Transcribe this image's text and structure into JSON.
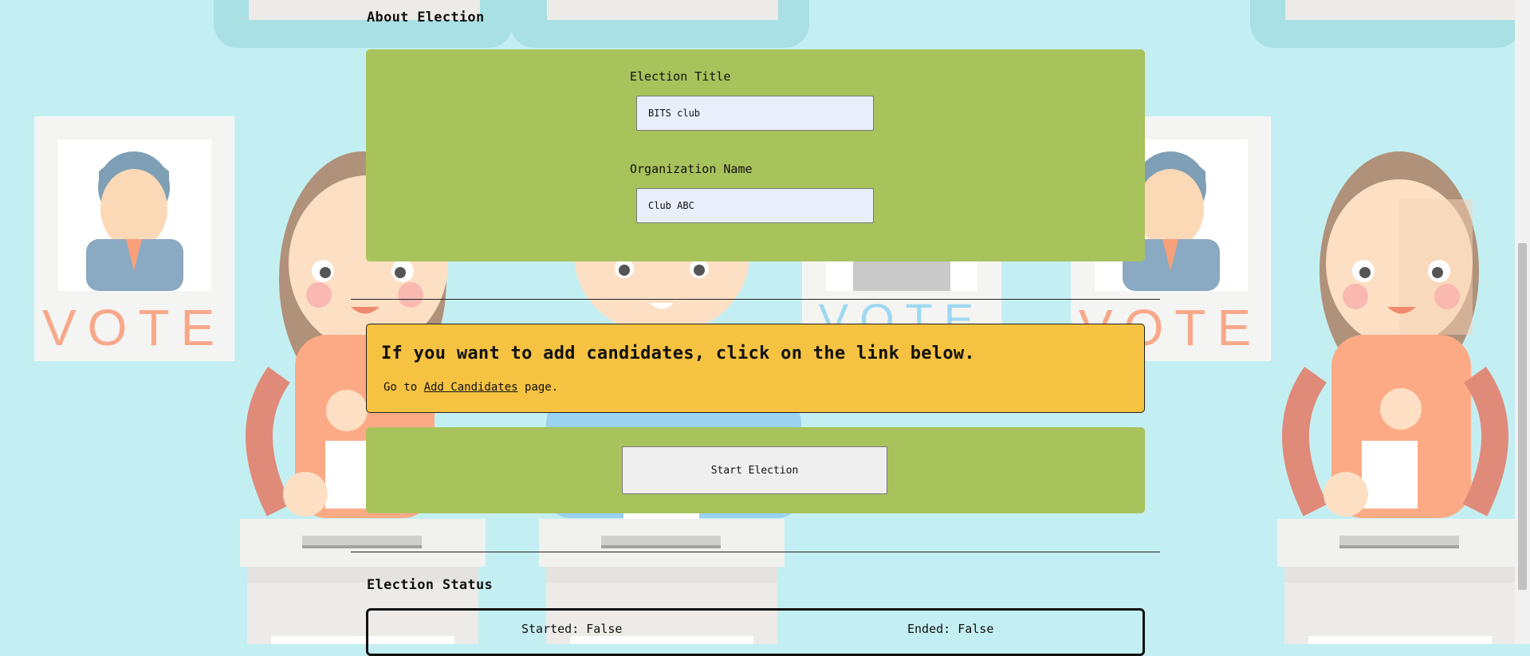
{
  "about": {
    "title": "About Election",
    "election_title_label": "Election Title",
    "election_title_value": "BITS club",
    "organization_name_label": "Organization Name",
    "organization_name_value": "Club ABC"
  },
  "candidates_notice": {
    "heading": "If you want to add candidates, click on the link below.",
    "prefix": "Go to ",
    "link_label": "Add Candidates",
    "suffix": " page."
  },
  "actions": {
    "start_label": "Start Election"
  },
  "status": {
    "title": "Election Status",
    "started": "Started: False",
    "ended": "Ended: False"
  },
  "background": {
    "vote_text": "VOTE"
  },
  "colors": {
    "page_bg": "#c4eff2",
    "card_green": "#a8c25c",
    "card_yellow": "#f5c242"
  }
}
